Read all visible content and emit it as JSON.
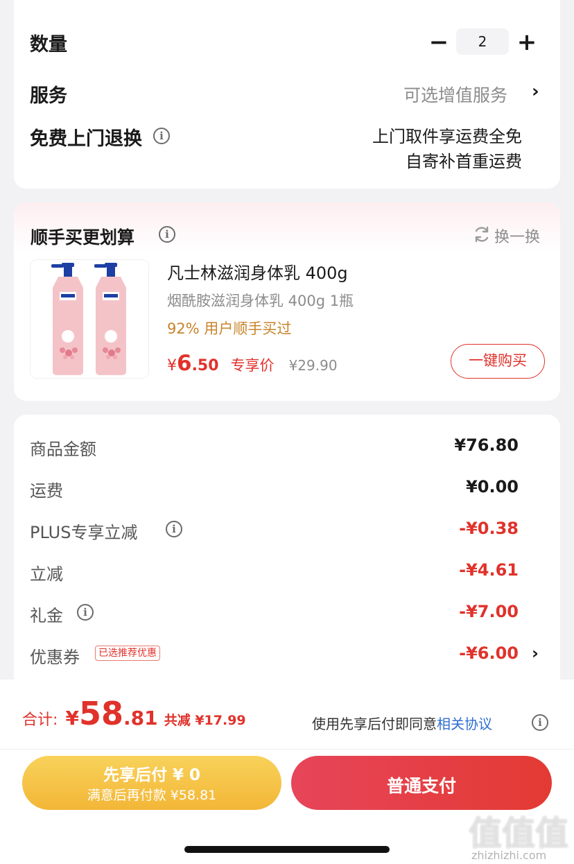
{
  "options": {
    "quantity_label": "数量",
    "quantity_value": "2",
    "minus_symbol": "−",
    "plus_symbol": "+",
    "service_label": "服务",
    "service_value": "可选增值服务",
    "chevron": "›",
    "return_label": "免费上门退换",
    "info_symbol": "i",
    "return_line1": "上门取件享运费全免",
    "return_line2": "自寄补首重运费"
  },
  "addon": {
    "title": "顺手买更划算",
    "swap_label": "换一换",
    "product_name": "凡士林滋润身体乳 400g",
    "product_desc": "烟酰胺滋润身体乳 400g 1瓶",
    "product_stat": "92% 用户顺手买过",
    "price_currency": "¥",
    "price_integer": "6",
    "price_decimal": ".50",
    "price_tag": "专享价",
    "original_price": "¥29.90",
    "buy_button": "一键购买"
  },
  "fees": {
    "items": [
      {
        "label": "商品金额",
        "value": "¥76.80"
      },
      {
        "label": "运费",
        "value": "¥0.00"
      },
      {
        "label": "PLUS专享立减",
        "value": "-¥0.38"
      },
      {
        "label": "立减",
        "value": "-¥4.61"
      },
      {
        "label": "礼金",
        "value": "-¥7.00"
      },
      {
        "label": "优惠券",
        "value": "-¥6.00"
      }
    ],
    "coupon_tag": "已选推荐优惠"
  },
  "footer": {
    "total_label": "合计:",
    "total_currency": "¥",
    "total_integer": "58",
    "total_decimal": ".81",
    "saved_label": "共减 ¥17.99",
    "agreement_prefix": "使用先享后付即同意",
    "agreement_link": "相关协议",
    "later_title": "先享后付 ¥ 0",
    "later_sub": "满意后再付款 ¥58.81",
    "pay_label": "普通支付"
  },
  "watermark": {
    "glyphs": "值值值",
    "url": "zhizhizhi.com"
  },
  "colors": {
    "accent_red": "#e0322b",
    "gold_text": "#c9832a",
    "link_blue": "#2f6fd0",
    "pay_later_yellow": "#f5c443"
  }
}
